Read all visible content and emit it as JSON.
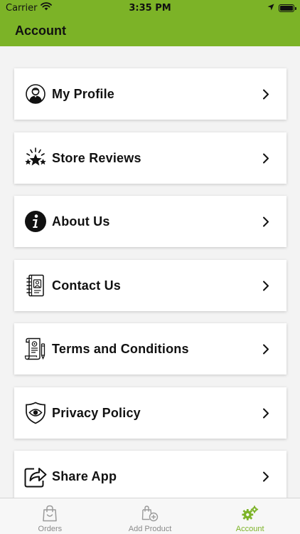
{
  "status_bar": {
    "carrier": "Carrier",
    "time": "3:35 PM",
    "icons": [
      "wifi-icon",
      "location-arrow-icon",
      "battery-icon"
    ]
  },
  "header": {
    "title": "Account",
    "color": "#7cb327"
  },
  "menu": {
    "items": [
      {
        "label": "My Profile",
        "icon": "user-profile-icon"
      },
      {
        "label": "Store Reviews",
        "icon": "stars-review-icon"
      },
      {
        "label": "About Us",
        "icon": "info-icon"
      },
      {
        "label": "Contact Us",
        "icon": "address-book-icon"
      },
      {
        "label": "Terms and Conditions",
        "icon": "document-certificate-icon"
      },
      {
        "label": "Privacy Policy",
        "icon": "shield-eye-icon"
      },
      {
        "label": "Share App",
        "icon": "share-icon"
      }
    ],
    "chevron_icon": "chevron-right-icon"
  },
  "tab_bar": {
    "tabs": [
      {
        "label": "Orders",
        "icon": "shopping-bag-icon",
        "active": false
      },
      {
        "label": "Add Product",
        "icon": "add-product-icon",
        "active": false
      },
      {
        "label": "Account",
        "icon": "gears-icon",
        "active": true
      }
    ],
    "active_color": "#7cb327",
    "inactive_color": "#8a8a8a"
  }
}
